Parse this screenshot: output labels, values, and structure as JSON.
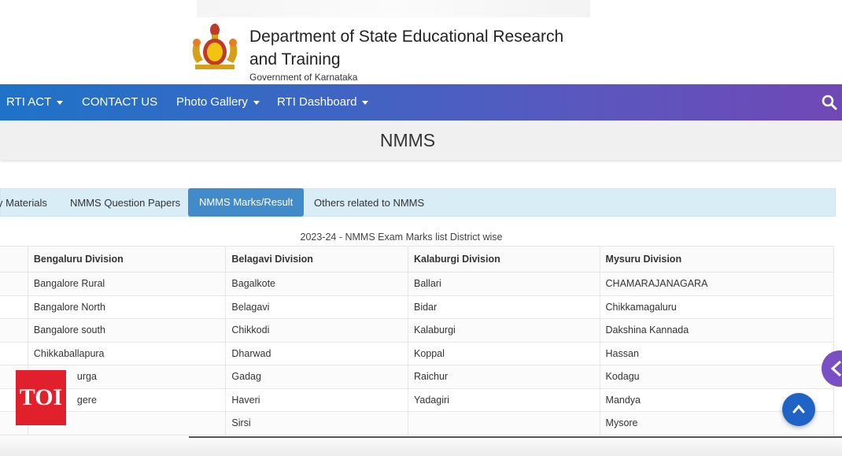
{
  "header": {
    "title": "Department of State Educational Research and Training",
    "subtitle": "Government of Karnataka"
  },
  "navbar": {
    "items": [
      {
        "label": "RTI ACT",
        "has_dropdown": true
      },
      {
        "label": "CONTACT US",
        "has_dropdown": false
      },
      {
        "label": "Photo Gallery",
        "has_dropdown": true
      },
      {
        "label": "RTI Dashboard",
        "has_dropdown": true
      }
    ],
    "search_icon": "search-icon"
  },
  "page": {
    "title": "NMMS"
  },
  "tabs": {
    "items": [
      {
        "label": "y Materials",
        "active": false
      },
      {
        "label": "NMMS Question Papers",
        "active": false
      },
      {
        "label": "NMMS Marks/Result",
        "active": true
      },
      {
        "label": "Others related to NMMS",
        "active": false
      }
    ]
  },
  "table": {
    "caption": "2023-24 - NMMS Exam Marks list District wise",
    "headers": [
      "Bengaluru Division",
      "Belagavi Division",
      "Kalaburgi Division",
      "Mysuru Division"
    ],
    "rows": [
      [
        "Bangalore Rural",
        "Bagalkote",
        "Ballari",
        "CHAMARAJANAGARA"
      ],
      [
        "Bangalore North",
        "Belagavi",
        "Bidar",
        "Chikkamagaluru"
      ],
      [
        "Bangalore south",
        "Chikkodi",
        "Kalaburgi",
        "Dakshina Kannada"
      ],
      [
        "Chikkaballapura",
        "Dharwad",
        "Koppal",
        "Hassan"
      ],
      [
        "urga",
        "Gadag",
        "Raichur",
        "Kodagu"
      ],
      [
        "gere",
        "Haveri",
        "Yadagiri",
        "Mandya"
      ],
      [
        "",
        "Sirsi",
        "",
        "Mysore"
      ]
    ]
  },
  "overlay": {
    "watermark": "TOI"
  },
  "colors": {
    "nav_start": "#1e73c8",
    "nav_end": "#7048b6",
    "active_tab": "#428bca",
    "tabs_bg": "#d9edf7",
    "toi_red": "#e0202b",
    "scroll_button": "#1f63c5"
  }
}
